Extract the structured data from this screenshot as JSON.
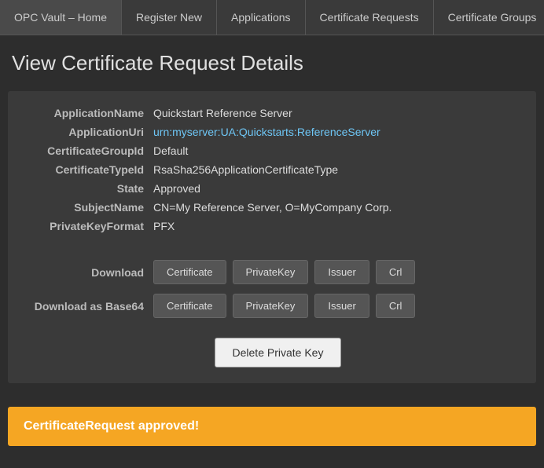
{
  "nav": {
    "items": [
      {
        "id": "home",
        "label": "OPC Vault – Home"
      },
      {
        "id": "register",
        "label": "Register New"
      },
      {
        "id": "applications",
        "label": "Applications"
      },
      {
        "id": "cert-requests",
        "label": "Certificate Requests"
      },
      {
        "id": "cert-groups",
        "label": "Certificate Groups"
      }
    ]
  },
  "page": {
    "title": "View Certificate Request Details"
  },
  "fields": [
    {
      "label": "ApplicationName",
      "value": "Quickstart Reference Server",
      "highlight": false
    },
    {
      "label": "ApplicationUri",
      "value": "urn:myserver:UA:Quickstarts:ReferenceServer",
      "highlight": true
    },
    {
      "label": "CertificateGroupId",
      "value": "Default",
      "highlight": false
    },
    {
      "label": "CertificateTypeId",
      "value": "RsaSha256ApplicationCertificateType",
      "highlight": false
    },
    {
      "label": "State",
      "value": "Approved",
      "highlight": false
    },
    {
      "label": "SubjectName",
      "value": "CN=My Reference Server, O=MyCompany Corp.",
      "highlight": false
    },
    {
      "label": "PrivateKeyFormat",
      "value": "PFX",
      "highlight": false
    }
  ],
  "download": {
    "label": "Download",
    "buttons": [
      "Certificate",
      "PrivateKey",
      "Issuer",
      "Crl"
    ]
  },
  "download_base64": {
    "label": "Download as Base64",
    "buttons": [
      "Certificate",
      "PrivateKey",
      "Issuer",
      "Crl"
    ]
  },
  "delete_button": {
    "label": "Delete Private Key"
  },
  "success_banner": {
    "message": "CertificateRequest approved!"
  }
}
